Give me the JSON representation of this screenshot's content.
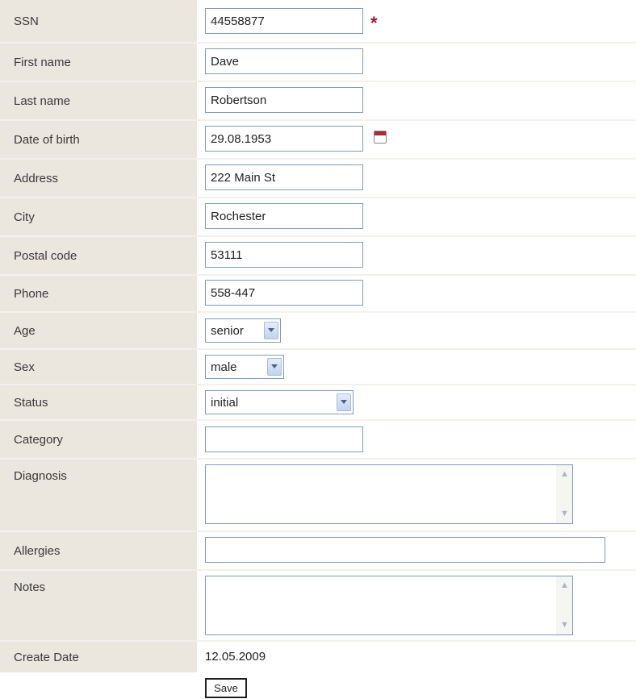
{
  "form": {
    "ssn": {
      "label": "SSN",
      "value": "44558877",
      "required_mark": "*"
    },
    "first_name": {
      "label": "First name",
      "value": "Dave"
    },
    "last_name": {
      "label": "Last name",
      "value": "Robertson"
    },
    "date_of_birth": {
      "label": "Date of birth",
      "value": "29.08.1953",
      "icon": "calendar-icon"
    },
    "address": {
      "label": "Address",
      "value": "222 Main St"
    },
    "city": {
      "label": "City",
      "value": "Rochester"
    },
    "postal_code": {
      "label": "Postal code",
      "value": "53111"
    },
    "phone": {
      "label": "Phone",
      "value": "558-447"
    },
    "age": {
      "label": "Age",
      "selected": "senior"
    },
    "sex": {
      "label": "Sex",
      "selected": "male"
    },
    "status": {
      "label": "Status",
      "selected": "initial"
    },
    "category": {
      "label": "Category",
      "value": ""
    },
    "diagnosis": {
      "label": "Diagnosis",
      "value": ""
    },
    "allergies": {
      "label": "Allergies",
      "value": ""
    },
    "notes": {
      "label": "Notes",
      "value": ""
    },
    "create_date": {
      "label": "Create Date",
      "value": "12.05.2009"
    },
    "save_label": "Save"
  },
  "colors": {
    "label_bg": "#ebe6de",
    "input_border": "#7f9db9",
    "required": "#a0152b",
    "calendar_accent": "#b3273a"
  }
}
